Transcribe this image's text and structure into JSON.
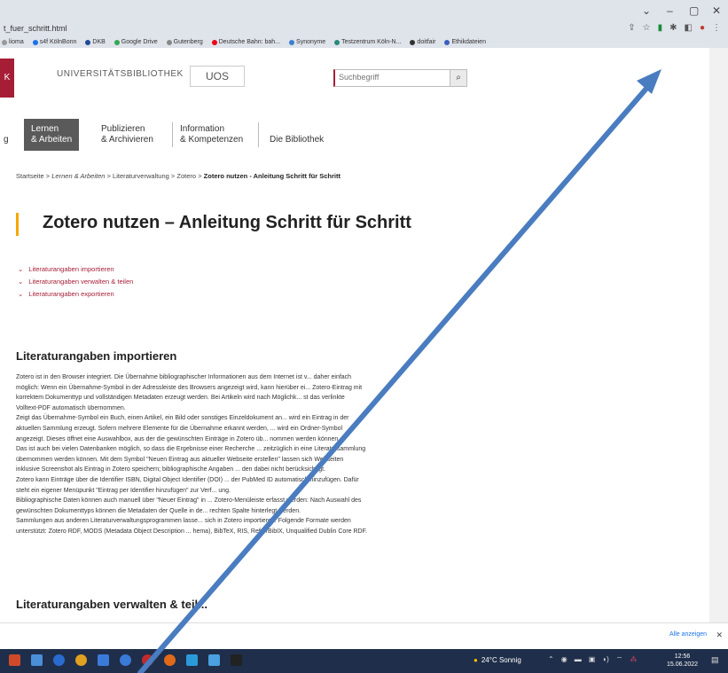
{
  "browser": {
    "url": "t_fuer_schritt.html",
    "window_controls": [
      "⌄",
      "–",
      "▢",
      "✕"
    ],
    "bookmarks": [
      {
        "label": "lioma",
        "color": "#999999"
      },
      {
        "label": "s4f KölnBonn",
        "color": "#1a73e8"
      },
      {
        "label": "DKB",
        "color": "#1e4a9c"
      },
      {
        "label": "Google Drive",
        "color": "#34a853"
      },
      {
        "label": "Gutenberg",
        "color": "#888888"
      },
      {
        "label": "Deutsche Bahn: bah...",
        "color": "#ec0016"
      },
      {
        "label": "Synonyme",
        "color": "#3c7fd0"
      },
      {
        "label": "Testzentrum Köln-N...",
        "color": "#2a8a7a"
      },
      {
        "label": "doitfair",
        "color": "#333333"
      },
      {
        "label": "Ethikdateien",
        "color": "#3a5fbf"
      }
    ]
  },
  "site": {
    "logo_letters": "K",
    "library_name": "UNIVERSITÄTSBIBLIOTHEK",
    "uos_logo": "UOS",
    "search_placeholder": "Suchbegriff",
    "nav": {
      "partial": "g",
      "active_line1": "Lernen",
      "active_line2": "& Arbeiten",
      "item2_line1": "Publizieren",
      "item2_line2": "& Archivieren",
      "item3_line1": "Information",
      "item3_line2": "& Kompetenzen",
      "item4": "Die Bibliothek"
    }
  },
  "breadcrumb": {
    "home": "Startseite",
    "sep": ">",
    "level1": "Lernen & Arbeiten",
    "level2": "Literaturverwaltung",
    "level3": "Zotero",
    "current": "Zotero nutzen - Anleitung Schritt für Schritt"
  },
  "page_title": "Zotero nutzen – Anleitung Schritt für Schritt",
  "toc": [
    "Literaturangaben importieren",
    "Literaturangaben verwalten & teilen",
    "Literaturangaben exportieren"
  ],
  "section1_heading": "Literaturangaben importieren",
  "section1_lines": [
    "Zotero ist in den Browser integriert. Die Übernahme bibliographischer Informationen aus dem Internet ist v... daher einfach",
    "möglich: Wenn ein Übernahme-Symbol in der Adressleiste des Browsers angezeigt wird, kann hierüber ei... Zotero-Eintrag mit",
    "korrektem Dokumenttyp und vollständigen Metadaten erzeugt werden. Bei Artikeln wird nach Möglichk... st das verlinkte",
    "Volltext-PDF automatisch übernommen.",
    "Zeigt das Übernahme-Symbol ein Buch, einen Artikel, ein Bild oder sonstiges Einzeldokument an... wird ein Eintrag in der",
    "aktuellen Sammlung erzeugt. Sofern mehrere Elemente für die Übernahme erkannt werden, ... wird ein Ordner-Symbol",
    "angezeigt. Dieses öffnet eine Auswahlbox, aus der die gewünschten Einträge in Zotero üb... nommen werden können.",
    "Das ist auch bei vielen Datenbanken möglich, so dass die Ergebnisse einer Recherche ... zeitzüglich in eine Literatursammlung",
    "übernommen werden können. Mit dem Symbol \"Neuen Eintrag aus aktueller Webseite erstellen\" lassen sich Webseiten",
    "inklusive Screenshot als Eintrag in Zotero speichern; bibliographische Angaben ... den dabei nicht berücksichtigt.",
    "Zotero kann Einträge über die Identifier ISBN, Digital Object Identifier (DOI) ... der PubMed ID automatisch hinzufügen. Dafür",
    "steht ein eigener Menüpunkt \"Eintrag per Identifier hinzufügen\" zur Verf... ung.",
    "Bibliographische Daten können auch manuell über \"Neuer Eintrag\" in ... Zotero-Menüleiste erfasst werden: Nach Auswahl des",
    "gewünschten Dokumenttyps können die Metadaten der Quelle in de... rechten Spalte hinterlegt werden.",
    "Sammlungen aus anderen Literaturverwaltungsprogrammen lasse... sich in Zotero importieren. Folgende Formate werden",
    "unterstützt: Zotero RDF, MODS (Metadata Object Description ... hema), BibTeX, RIS, Refer/BibIX, Unqualified Dublin Core RDF."
  ],
  "section2_heading": "Literaturangaben verwalten & teil...",
  "notification": {
    "show_all": "Alle anzeigen",
    "close": "✕"
  },
  "taskbar": {
    "weather": "24°C Sonnig",
    "time": "12:56",
    "date": "15.06.2022"
  },
  "colors": {
    "brand_red": "#a51e36",
    "accent_yellow": "#f6a800",
    "arrow_blue": "#4a7cc0",
    "taskbar": "#1f2e4a"
  }
}
